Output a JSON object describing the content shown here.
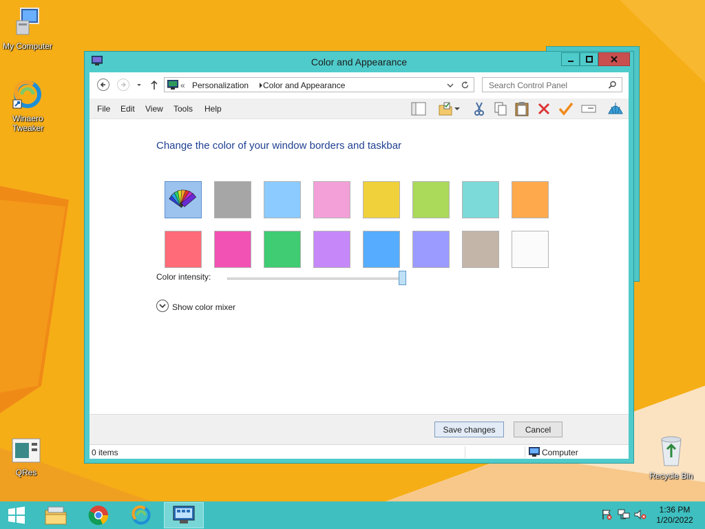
{
  "desktop": {
    "icons": [
      {
        "label": "My Computer"
      },
      {
        "label": "Winaero Tweaker"
      },
      {
        "label": "QRes"
      },
      {
        "label": "Recycle Bin"
      }
    ]
  },
  "window": {
    "title": "Color and Appearance",
    "caption_buttons": {
      "minimize": "minimize-icon",
      "maximize": "maximize-icon",
      "close": "close-icon"
    },
    "address": {
      "overflow": "«",
      "crumbs": [
        "Personalization",
        "Color and Appearance"
      ]
    },
    "search": {
      "placeholder": "Search Control Panel"
    },
    "menu": [
      "File",
      "Edit",
      "View",
      "Tools",
      "Help"
    ],
    "toolbar_icons": [
      "layout-pane-icon",
      "folder-options-icon",
      "cut-icon",
      "copy-icon",
      "paste-icon",
      "delete-icon",
      "properties-icon",
      "rename-icon",
      "seashell-icon"
    ],
    "content": {
      "heading": "Change the color of your window borders and taskbar",
      "swatches": [
        {
          "name": "automatic",
          "color": "#8ab6e6",
          "selected": true
        },
        {
          "name": "gray",
          "color": "#a6a6a6"
        },
        {
          "name": "sky",
          "color": "#8ccbff"
        },
        {
          "name": "pink",
          "color": "#f3a0d8"
        },
        {
          "name": "yellow",
          "color": "#f0d13c"
        },
        {
          "name": "green",
          "color": "#abd95a"
        },
        {
          "name": "teal",
          "color": "#7cdad8"
        },
        {
          "name": "orange",
          "color": "#ffa94d"
        },
        {
          "name": "red",
          "color": "#ff6b78"
        },
        {
          "name": "magenta",
          "color": "#f152b3"
        },
        {
          "name": "emerald",
          "color": "#3fcc73"
        },
        {
          "name": "violet",
          "color": "#c688f8"
        },
        {
          "name": "blue",
          "color": "#56acff"
        },
        {
          "name": "periwinkle",
          "color": "#9b9bff"
        },
        {
          "name": "taupe",
          "color": "#c3b5a8"
        },
        {
          "name": "white",
          "color": "#fbfbfb"
        }
      ],
      "intensity_label": "Color intensity:",
      "intensity_value": 1.0,
      "mixer_label": "Show color mixer"
    },
    "footer": {
      "save_label": "Save changes",
      "cancel_label": "Cancel"
    },
    "status": {
      "items": "0 items",
      "location": "Computer"
    }
  },
  "taskbar": {
    "clock_time": "1:36 PM",
    "clock_date": "1/20/2022",
    "tray_icons": [
      "action-center-icon",
      "network-icon",
      "volume-muted-icon"
    ]
  },
  "colors": {
    "desktop_bg": "#f6ae17",
    "window_frame": "#4fcbcb",
    "taskbar": "#3fbfbf",
    "heading": "#1e3f91"
  }
}
